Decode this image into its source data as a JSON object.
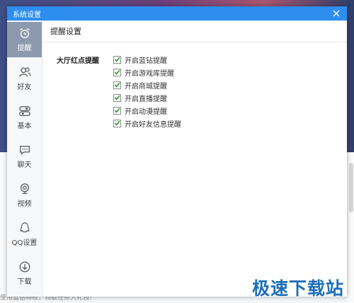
{
  "dialog": {
    "title": "系统设置",
    "close_icon": "close-icon"
  },
  "sidebar": {
    "items": [
      {
        "label": "提醒",
        "icon": "alarm-clock-icon",
        "active": true
      },
      {
        "label": "好友",
        "icon": "friends-icon",
        "active": false
      },
      {
        "label": "基本",
        "icon": "toggle-settings-icon",
        "active": false
      },
      {
        "label": "聊天",
        "icon": "chat-bubble-icon",
        "active": false
      },
      {
        "label": "视频",
        "icon": "webcam-icon",
        "active": false
      },
      {
        "label": "QQ设置",
        "icon": "penguin-icon",
        "active": false
      },
      {
        "label": "下载",
        "icon": "download-icon",
        "active": false
      }
    ]
  },
  "content": {
    "header": "提醒设置",
    "section_label": "大厅红点提醒",
    "options": [
      {
        "label": "开启蓝钻提醒",
        "checked": true
      },
      {
        "label": "开启游戏库提醒",
        "checked": true
      },
      {
        "label": "开启商城提醒",
        "checked": true
      },
      {
        "label": "开启直播提醒",
        "checked": true
      },
      {
        "label": "开启动漫提醒",
        "checked": true
      },
      {
        "label": "开启好友信息提醒",
        "checked": true
      }
    ]
  },
  "watermark": "极速下载站",
  "background_text": "使用蓝钻特权，领取任务大礼包！",
  "colors": {
    "titlebar": "#2d8ef0",
    "active_nav": "#8d99ae",
    "checkmark": "#2a9d2a",
    "watermark": "#1f6fb8"
  }
}
